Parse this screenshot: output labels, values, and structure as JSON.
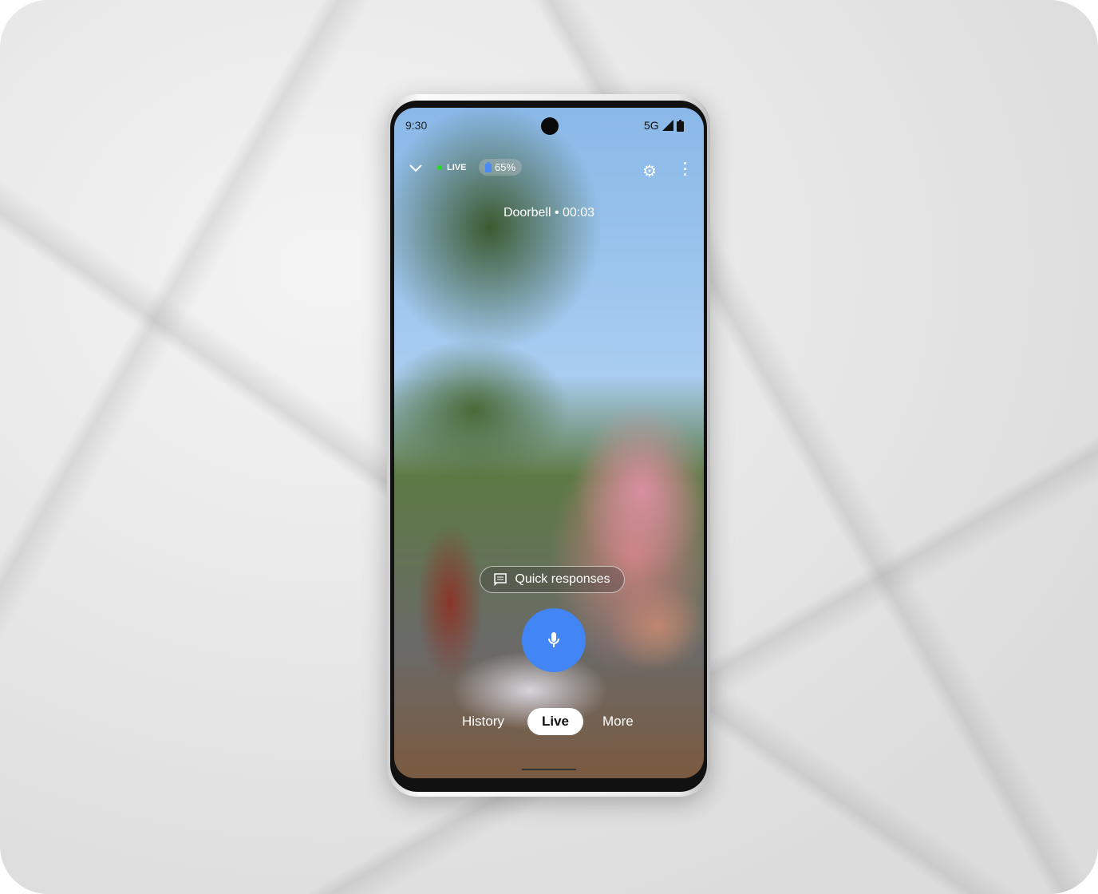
{
  "status_bar": {
    "time": "9:30",
    "network": "5G",
    "signal_icon": "signal-icon",
    "battery_icon": "battery-icon"
  },
  "header": {
    "live_label": "LIVE",
    "live_dot_color": "#22dd22",
    "battery_percent": "65%",
    "title": "Doorbell • 00:03"
  },
  "actions": {
    "quick_responses": "Quick responses",
    "mic_color": "#4285f4"
  },
  "tabs": [
    {
      "label": "History"
    },
    {
      "label": "Live",
      "selected": true
    },
    {
      "label": "More"
    }
  ]
}
